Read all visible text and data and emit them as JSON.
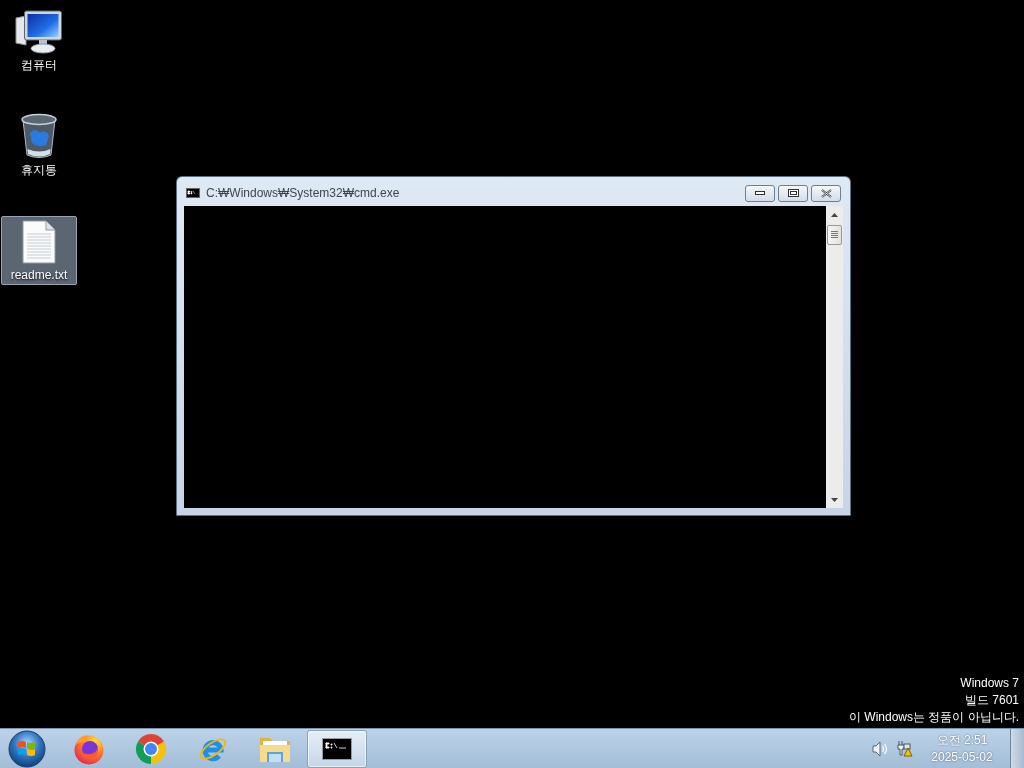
{
  "desktop_icons": [
    {
      "label": "컴퓨터",
      "kind": "computer",
      "selected": false
    },
    {
      "label": "휴지통",
      "kind": "recycle-bin",
      "selected": false
    },
    {
      "label": "readme.txt",
      "kind": "text-file",
      "selected": true
    }
  ],
  "window": {
    "title": "C:₩Windows₩System32₩cmd.exe"
  },
  "os_notice": [
    "Windows 7",
    "빌드 7601",
    "이 Windows는 정품이 아닙니다."
  ],
  "taskbar": {
    "pinned": [
      {
        "kind": "firefox",
        "selected": false
      },
      {
        "kind": "chrome",
        "selected": false
      },
      {
        "kind": "internet-explorer",
        "selected": false
      },
      {
        "kind": "file-explorer",
        "selected": false
      },
      {
        "kind": "command-prompt",
        "selected": true
      }
    ],
    "clock": {
      "time": "오전 2:51",
      "date": "2025-05-02"
    }
  }
}
